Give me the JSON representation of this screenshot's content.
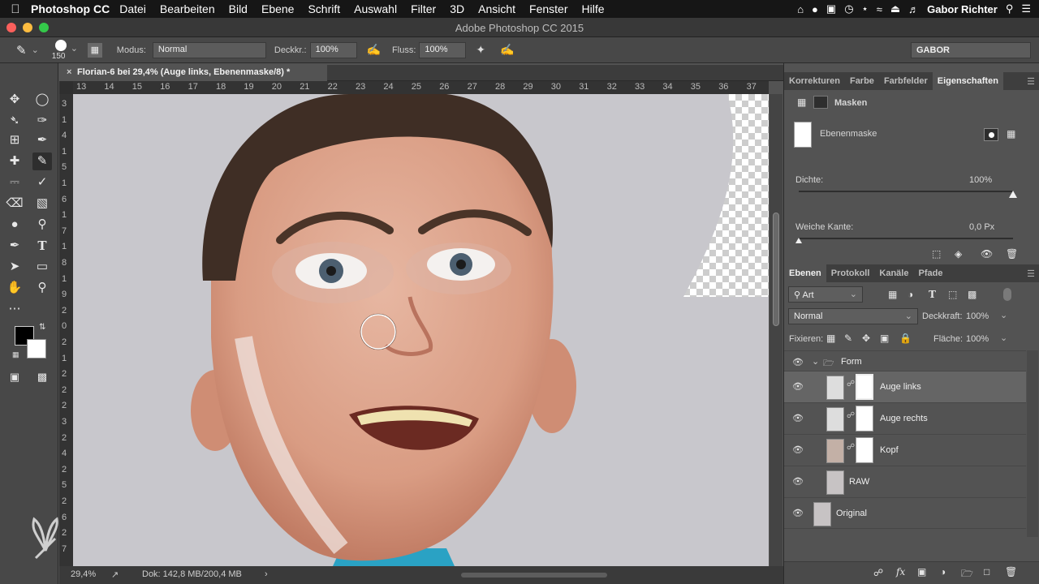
{
  "menubar": {
    "app": "Photoshop CC",
    "items": [
      "Datei",
      "Bearbeiten",
      "Bild",
      "Ebene",
      "Schrift",
      "Auswahl",
      "Filter",
      "3D",
      "Ansicht",
      "Fenster",
      "Hilfe"
    ],
    "user": "Gabor Richter"
  },
  "window": {
    "title": "Adobe Photoshop CC 2015"
  },
  "options": {
    "brush_size": "150",
    "mode_label": "Modus:",
    "mode_value": "Normal",
    "opacity_label": "Deckkr.:",
    "opacity_value": "100%",
    "flow_label": "Fluss:",
    "flow_value": "100%",
    "workspace": "GABOR"
  },
  "document": {
    "tab_title": "Florian-6 bei 29,4% (Auge links, Ebenenmaske/8) *",
    "ruler_h": [
      "13",
      "14",
      "15",
      "16",
      "17",
      "18",
      "19",
      "20",
      "21",
      "22",
      "23",
      "24",
      "25",
      "26",
      "27",
      "28",
      "29",
      "30",
      "31",
      "32",
      "33",
      "34",
      "35",
      "36",
      "37"
    ],
    "ruler_v": [
      "3",
      "1",
      "4",
      "1",
      "5",
      "1",
      "6",
      "1",
      "7",
      "1",
      "8",
      "1",
      "9",
      "2",
      "0",
      "2",
      "1",
      "2",
      "2",
      "2",
      "3",
      "2",
      "4",
      "2",
      "5",
      "2",
      "6",
      "2",
      "7"
    ]
  },
  "status": {
    "zoom": "29,4%",
    "doc": "Dok: 142,8 MB/200,4 MB"
  },
  "properties": {
    "tabs": [
      "Korrekturen",
      "Farbe",
      "Farbfelder",
      "Eigenschaften"
    ],
    "active_tab": "Eigenschaften",
    "section": "Masken",
    "mask_type": "Ebenenmaske",
    "density_label": "Dichte:",
    "density_value": "100%",
    "density": 1.0,
    "feather_label": "Weiche Kante:",
    "feather_value": "0,0 Px",
    "feather": 0.0
  },
  "layers": {
    "tabs": [
      "Ebenen",
      "Protokoll",
      "Kanäle",
      "Pfade"
    ],
    "filter": "Art",
    "blend": "Normal",
    "opacity_label": "Deckkraft:",
    "opacity_value": "100%",
    "lock_label": "Fixieren:",
    "fill_label": "Fläche:",
    "fill_value": "100%",
    "items": [
      {
        "name": "Form"
      },
      {
        "name": "Auge links"
      },
      {
        "name": "Auge rechts"
      },
      {
        "name": "Kopf"
      },
      {
        "name": "RAW"
      },
      {
        "name": "Original"
      }
    ]
  },
  "colors": {
    "accent_selected_layer": "#656565",
    "foreground": "#000000",
    "background": "#ffffff"
  }
}
